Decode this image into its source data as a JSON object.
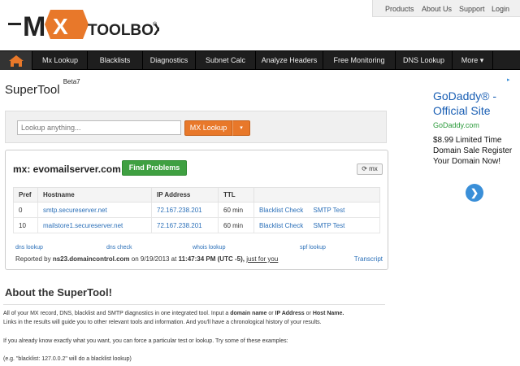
{
  "brand": {
    "name": "TOOLBOX",
    "mark": "MX",
    "registered": "®"
  },
  "toplinks": [
    "Products",
    "About Us",
    "Support",
    "Login"
  ],
  "nav": {
    "items": [
      "Mx Lookup",
      "Blacklists",
      "Diagnostics",
      "Subnet Calc",
      "Analyze Headers",
      "Free Monitoring",
      "DNS Lookup",
      "More ▾"
    ]
  },
  "supertool": {
    "title": "SuperTool",
    "beta": "Beta7",
    "search_placeholder": "Lookup anything...",
    "search_value": "",
    "button_label": "MX Lookup",
    "caret": "▾"
  },
  "result": {
    "title": "mx: evomailserver.com",
    "find_label": "Find Problems",
    "refresh_label": "mx",
    "columns": [
      "Pref",
      "Hostname",
      "IP Address",
      "TTL",
      ""
    ],
    "rows": [
      {
        "pref": "0",
        "hostname": "smtp.secureserver.net",
        "ip": "72.167.238.201",
        "ttl": "60 min",
        "action1": "Blacklist Check",
        "action2": "SMTP Test"
      },
      {
        "pref": "10",
        "hostname": "mailstore1.secureserver.net",
        "ip": "72.167.238.201",
        "ttl": "60 min",
        "action1": "Blacklist Check",
        "action2": "SMTP Test"
      }
    ],
    "links": [
      "dns lookup",
      "dns check",
      "whois lookup",
      "spf lookup"
    ],
    "reported_prefix": "Reported by",
    "reported_server": "ns23.domaincontrol.com",
    "reported_on": "on 9/19/2013 at",
    "reported_time": "11:47:34 PM (UTC -5),",
    "reported_suffix": "just for you",
    "transcript": "Transcript"
  },
  "about": {
    "title": "About the SuperTool!",
    "line1a": "All of your MX record, DNS, blacklist and SMTP diagnostics in one integrated tool.  Input a",
    "line1b": "domain name",
    "line1c": "or",
    "line1d": "IP Address",
    "line1e": "or",
    "line1f": "Host Name.",
    "line2": "Links in the results will guide you to other relevant tools and information.  And you'll have a chronological history of your results.",
    "line3": "If you already know exactly what you want, you can force a particular test or lookup.  Try some of these examples:",
    "line4": "(e.g. \"blacklist: 127.0.0.2\" will do a blacklist lookup)"
  },
  "ad": {
    "title": "GoDaddy® - Official Site",
    "url": "GoDaddy.com",
    "description": "$8.99 Limited Time Domain Sale Register Your Domain Now!",
    "arrow": "❯"
  },
  "colors": {
    "nav_bg": "#1e1e1e",
    "accent_orange": "#e8782a",
    "accent_green": "#3fa041",
    "link_blue": "#2a6fb8"
  }
}
